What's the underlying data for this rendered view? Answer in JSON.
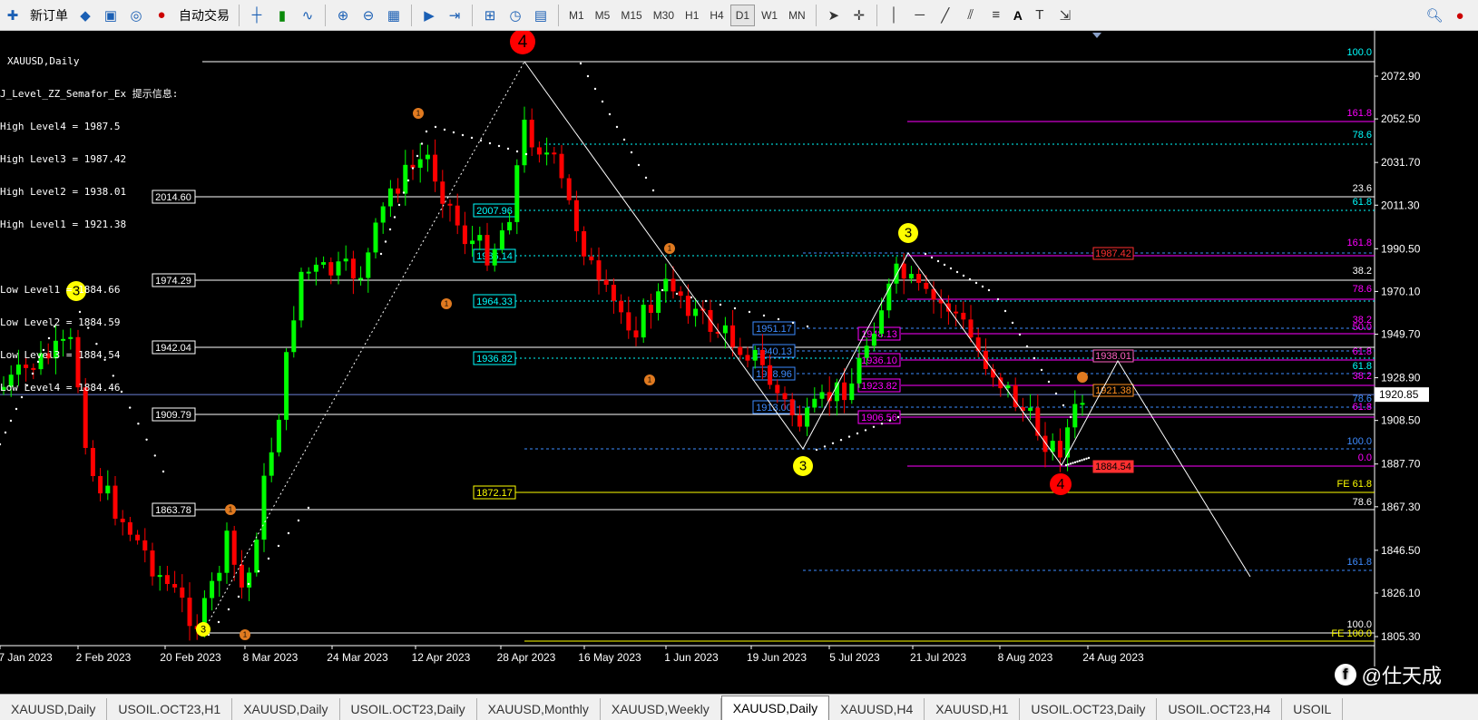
{
  "toolbar": {
    "new_order": "新订单",
    "auto_trade": "自动交易",
    "timeframes": [
      "M1",
      "M5",
      "M15",
      "M30",
      "H1",
      "H4",
      "D1",
      "W1",
      "MN"
    ],
    "active_timeframe": "D1",
    "text_tool": "A"
  },
  "chart": {
    "symbol": "XAUUSD,Daily",
    "indicator_title": "J_Level_ZZ_Semafor_Ex 提示信息:",
    "high_levels": [
      "High Level4 = 1987.5",
      "High Level3 = 1987.42",
      "High Level2 = 1938.01",
      "High Level1 = 1921.38"
    ],
    "low_levels": [
      "Low Level1 = 1884.66",
      "Low Level2 = 1884.59",
      "Low Level3 = 1884.54",
      "Low Level4 = 1884.46"
    ],
    "current_price": "1920.85",
    "price_axis": [
      "2072.90",
      "2052.50",
      "2031.70",
      "2011.30",
      "1990.50",
      "1970.10",
      "1949.70",
      "1928.90",
      "1908.50",
      "1887.70",
      "1867.30",
      "1846.50",
      "1826.10",
      "1805.30"
    ],
    "date_axis": [
      "7 Jan 2023",
      "2 Feb 2023",
      "20 Feb 2023",
      "8 Mar 2023",
      "24 Mar 2023",
      "12 Apr 2023",
      "28 Apr 2023",
      "16 May 2023",
      "1 Jun 2023",
      "19 Jun 2023",
      "5 Jul 2023",
      "21 Jul 2023",
      "8 Aug 2023",
      "24 Aug 2023"
    ],
    "white_levels": [
      "2014.60",
      "1974.29",
      "1942.04",
      "1909.79",
      "1863.78"
    ],
    "fib_a_labels": [
      "2007.96",
      "1986.14",
      "1964.33",
      "1936.82"
    ],
    "fib_a_yellow": "1872.17",
    "fib_b_labels": [
      "1951.17",
      "1940.13",
      "1928.96",
      "1913.00"
    ],
    "fib_c_labels": [
      "1948.13",
      "1936.10",
      "1923.82",
      "1906.56"
    ],
    "red_price_box_top": "1987.42",
    "red_price_box_bottom": "1884.54",
    "pink_box": "1938.01",
    "orange_box": "1921.38",
    "right_fib_labels": [
      "100.0",
      "161.8",
      "78.6",
      "23.6",
      "61.8",
      "161.8",
      "38.2",
      "78.6",
      "38.2",
      "50.0",
      "61.8",
      "61.8",
      "38.2",
      "78.6",
      "61.8",
      "100.0",
      "0.0",
      "FE 61.8",
      "78.6",
      "161.8",
      "100.0",
      "FE 100.0"
    ],
    "semafor_markers": [
      "4",
      "3",
      "3",
      "3",
      "4",
      "1",
      "1",
      "1",
      "1",
      "1",
      "1",
      "3"
    ]
  },
  "tabs": [
    "XAUUSD,Daily",
    "USOIL.OCT23,H1",
    "XAUUSD,Daily",
    "USOIL.OCT23,Daily",
    "XAUUSD,Monthly",
    "XAUUSD,Weekly",
    "XAUUSD,Daily",
    "XAUUSD,H4",
    "XAUUSD,H1",
    "USOIL.OCT23,Daily",
    "USOIL.OCT23,H4",
    "USOIL"
  ],
  "active_tab_index": 6,
  "watermark": "@仕天成",
  "colors": {
    "bull": "#00ff00",
    "bear": "#ff0000",
    "background": "#000000",
    "cyan": "#00ffff",
    "magenta": "#ff00ff",
    "yellow": "#ffff00"
  }
}
